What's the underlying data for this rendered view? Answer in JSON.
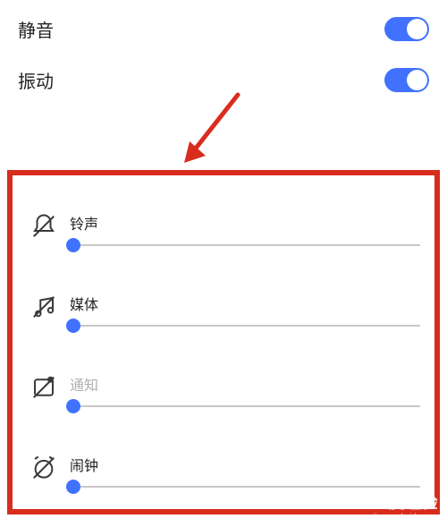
{
  "toggles": {
    "mute": {
      "label": "静音",
      "on": true
    },
    "vibrate": {
      "label": "振动",
      "on": true
    }
  },
  "sliders": {
    "ringtone": {
      "label": "铃声",
      "value": 0,
      "disabled": false
    },
    "media": {
      "label": "媒体",
      "value": 0,
      "disabled": false
    },
    "notify": {
      "label": "通知",
      "value": 0,
      "disabled": true
    },
    "alarm": {
      "label": "闹钟",
      "value": 0,
      "disabled": false
    }
  },
  "accentColor": "#4071ff",
  "highlightColor": "#d82c1d",
  "watermark": {
    "logo": "Bai度经验",
    "sub": "jingyan.baidu.com"
  }
}
